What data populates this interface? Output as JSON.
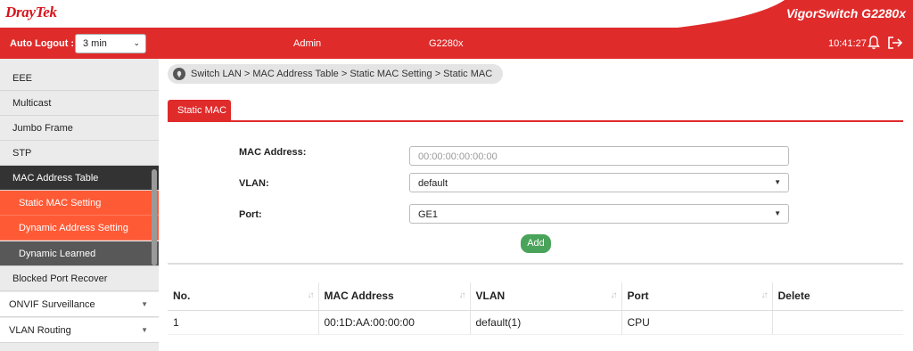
{
  "brand": {
    "logo_text": "DrayTek",
    "model_title": "VigorSwitch G2280x"
  },
  "topbar": {
    "auto_logout_label": "Auto Logout :",
    "auto_logout_value": "3 min",
    "user": "Admin",
    "model": "G2280x",
    "time": "10:41:27",
    "icons": [
      "bell-icon",
      "logout-icon"
    ]
  },
  "sidebar": {
    "items": [
      {
        "label": "EEE"
      },
      {
        "label": "Multicast"
      },
      {
        "label": "Jumbo Frame"
      },
      {
        "label": "STP"
      },
      {
        "label": "MAC Address Table"
      },
      {
        "label": "Static MAC Setting"
      },
      {
        "label": "Dynamic Address Setting"
      },
      {
        "label": "Dynamic Learned"
      },
      {
        "label": "Blocked Port Recover"
      },
      {
        "label": "ONVIF Surveillance"
      },
      {
        "label": "VLAN Routing"
      }
    ]
  },
  "breadcrumb": "Switch LAN > MAC Address Table > Static MAC Setting  > Static MAC",
  "tab": {
    "label": "Static MAC"
  },
  "form": {
    "mac_label": "MAC Address:",
    "mac_placeholder": "00:00:00:00:00:00",
    "vlan_label": "VLAN:",
    "vlan_value": "default",
    "port_label": "Port:",
    "port_value": "GE1",
    "add_label": "Add"
  },
  "table": {
    "headers": [
      "No.",
      "MAC Address",
      "VLAN",
      "Port",
      "Delete"
    ],
    "rows": [
      [
        "1",
        "00:1D:AA:00:00:00",
        "default(1)",
        "CPU",
        ""
      ]
    ]
  },
  "colors": {
    "brand_red": "#e02b2b",
    "sub_orange": "#ff5a36",
    "add_green": "#4aa35a"
  }
}
